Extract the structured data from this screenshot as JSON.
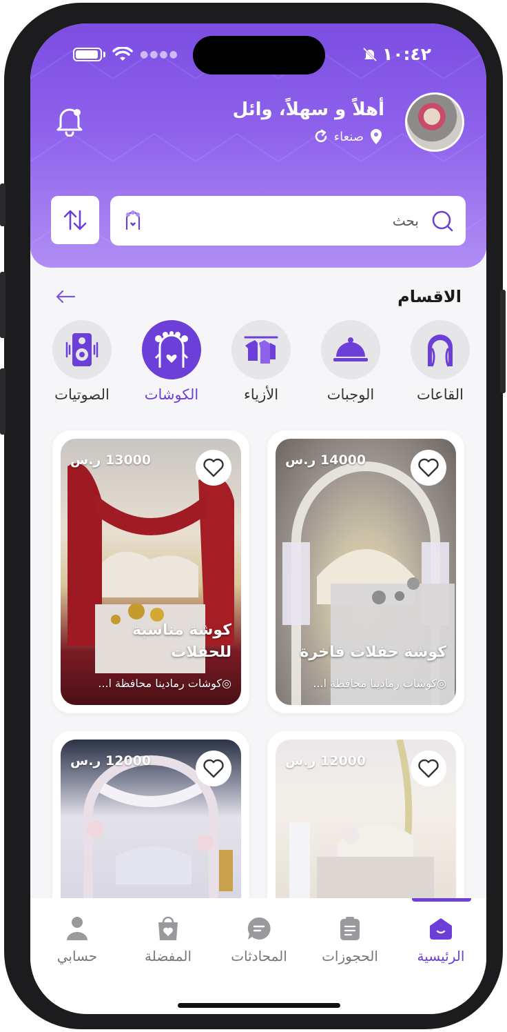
{
  "status": {
    "time": "١٠:٤٢"
  },
  "header": {
    "greeting": "أهلاً و سهلاً، وائل",
    "location": "صنعاء"
  },
  "search": {
    "placeholder": "بحث"
  },
  "categories": {
    "title": "الاقسام",
    "items": [
      {
        "label": "القاعات",
        "icon": "arch-icon"
      },
      {
        "label": "الوجبات",
        "icon": "food-dome-icon"
      },
      {
        "label": "الأزياء",
        "icon": "clothes-rack-icon"
      },
      {
        "label": "الكوشات",
        "icon": "wedding-stage-icon",
        "active": true
      },
      {
        "label": "الصوتيات",
        "icon": "speaker-icon"
      }
    ]
  },
  "listings": [
    {
      "price": "14000 ر.س",
      "title": "كوشة حفلات فاخرة",
      "location": "كوشات رمادينا محافظة ا..."
    },
    {
      "price": "13000 ر.س",
      "title": "كوشة مناسبة للحفلات",
      "location": "كوشات رمادينا محافظة ا..."
    },
    {
      "price": "12000 ر.س",
      "title": "",
      "location": ""
    },
    {
      "price": "12000 ر.س",
      "title": "",
      "location": ""
    }
  ],
  "tabs": [
    {
      "label": "الرئيسية",
      "active": true
    },
    {
      "label": "الحجوزات"
    },
    {
      "label": "المحادثات"
    },
    {
      "label": "المفضلة"
    },
    {
      "label": "حسابي"
    }
  ],
  "colors": {
    "primary": "#6b3fd8",
    "header_top": "#7b4de2",
    "header_bottom": "#b08ef4"
  }
}
